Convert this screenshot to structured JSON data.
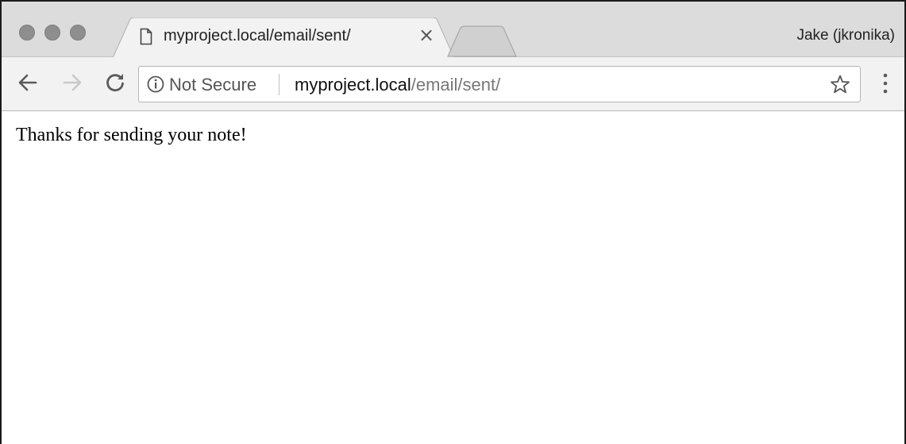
{
  "window": {
    "traffic_lights": [
      "close",
      "minimize",
      "zoom"
    ],
    "profile_name": "Jake (jkronika)"
  },
  "tab": {
    "title": "myproject.local/email/sent/",
    "close_glyph": "×",
    "icon": "document-icon"
  },
  "toolbar": {
    "back_icon": "arrow-left-icon",
    "forward_icon": "arrow-right-icon",
    "reload_icon": "reload-icon",
    "security_label": "Not Secure",
    "url_host": "myproject.local",
    "url_path": "/email/sent/",
    "bookmark_icon": "star-icon",
    "menu_icon": "vertical-dots-icon"
  },
  "page": {
    "message": "Thanks for sending your note!"
  }
}
